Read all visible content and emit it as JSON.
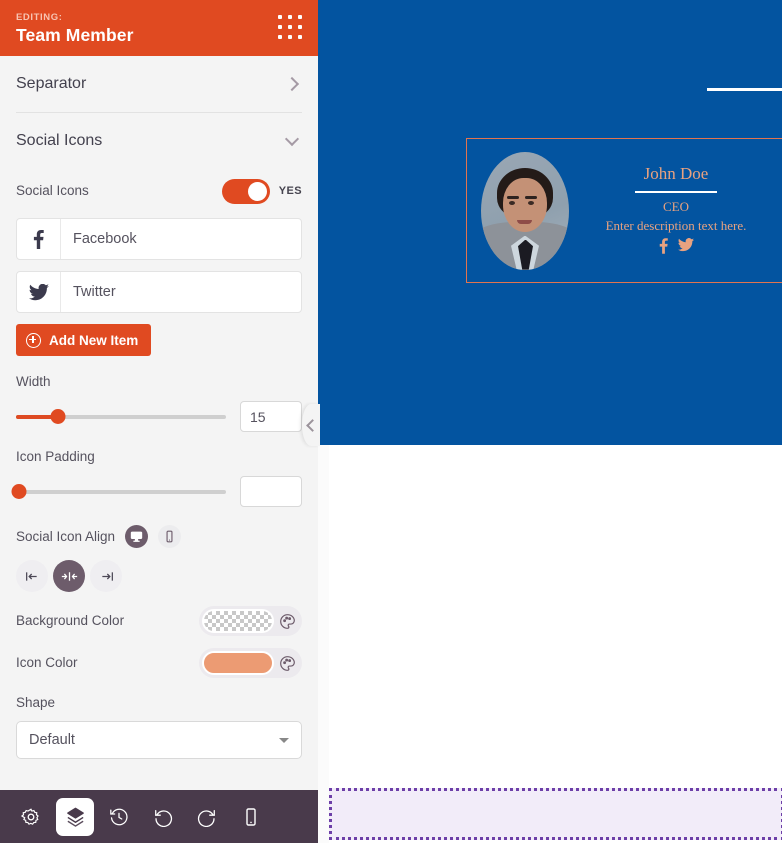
{
  "panel": {
    "header": {
      "eyebrow": "EDITING:",
      "title": "Team Member",
      "grid_icon": "apps-grid-icon"
    },
    "sections": [
      {
        "label": "Separator",
        "state": "collapsed",
        "chevron": "chevron-right-icon"
      },
      {
        "label": "Social Icons",
        "state": "expanded",
        "chevron": "chevron-down-icon"
      }
    ],
    "social_icons_toggle": {
      "label": "Social Icons",
      "value": "YES",
      "enabled": true
    },
    "repeater": {
      "items": [
        {
          "icon": "facebook-icon",
          "title": "Facebook"
        },
        {
          "icon": "twitter-icon",
          "title": "Twitter"
        }
      ],
      "add_button": "Add New Item",
      "add_icon": "plus-circle-icon"
    },
    "width": {
      "label": "Width",
      "value": "15",
      "placeholder": "",
      "percent": 20
    },
    "icon_padding": {
      "label": "Icon Padding",
      "value": "",
      "placeholder": "",
      "percent": 0
    },
    "align": {
      "label": "Social Icon Align",
      "devices": [
        {
          "name": "desktop-icon",
          "active": true
        },
        {
          "name": "mobile-icon",
          "active": false
        }
      ],
      "options": [
        {
          "name": "align-left-icon",
          "active": false
        },
        {
          "name": "align-center-icon",
          "active": true
        },
        {
          "name": "align-right-icon",
          "active": false
        }
      ]
    },
    "background_color": {
      "label": "Background Color",
      "value": "transparent",
      "picker_icon": "palette-icon"
    },
    "icon_color": {
      "label": "Icon Color",
      "value": "#EC9B73",
      "picker_icon": "palette-icon"
    },
    "shape": {
      "label": "Shape",
      "selected": "Default",
      "caret_icon": "caret-down-icon"
    },
    "bottom_bar": [
      {
        "name": "settings-gear-icon",
        "active": false
      },
      {
        "name": "layers-icon",
        "active": true
      },
      {
        "name": "history-icon",
        "active": false
      },
      {
        "name": "undo-icon",
        "active": false
      },
      {
        "name": "redo-icon",
        "active": false
      },
      {
        "name": "responsive-mobile-icon",
        "active": false
      }
    ]
  },
  "canvas": {
    "collapse_handle_icon": "chevron-left-icon",
    "section_bg": "#0354A0",
    "card": {
      "border_color": "#E2744F",
      "name": "John Doe",
      "role": "CEO",
      "description": "Enter description text here.",
      "text_color": "#E8A280",
      "socials": [
        {
          "name": "facebook-icon"
        },
        {
          "name": "twitter-icon"
        }
      ],
      "avatar_name": "team-member-photo"
    },
    "drop_zone": {
      "name": "empty-drop-zone",
      "border_color": "#6D3FA8"
    }
  }
}
